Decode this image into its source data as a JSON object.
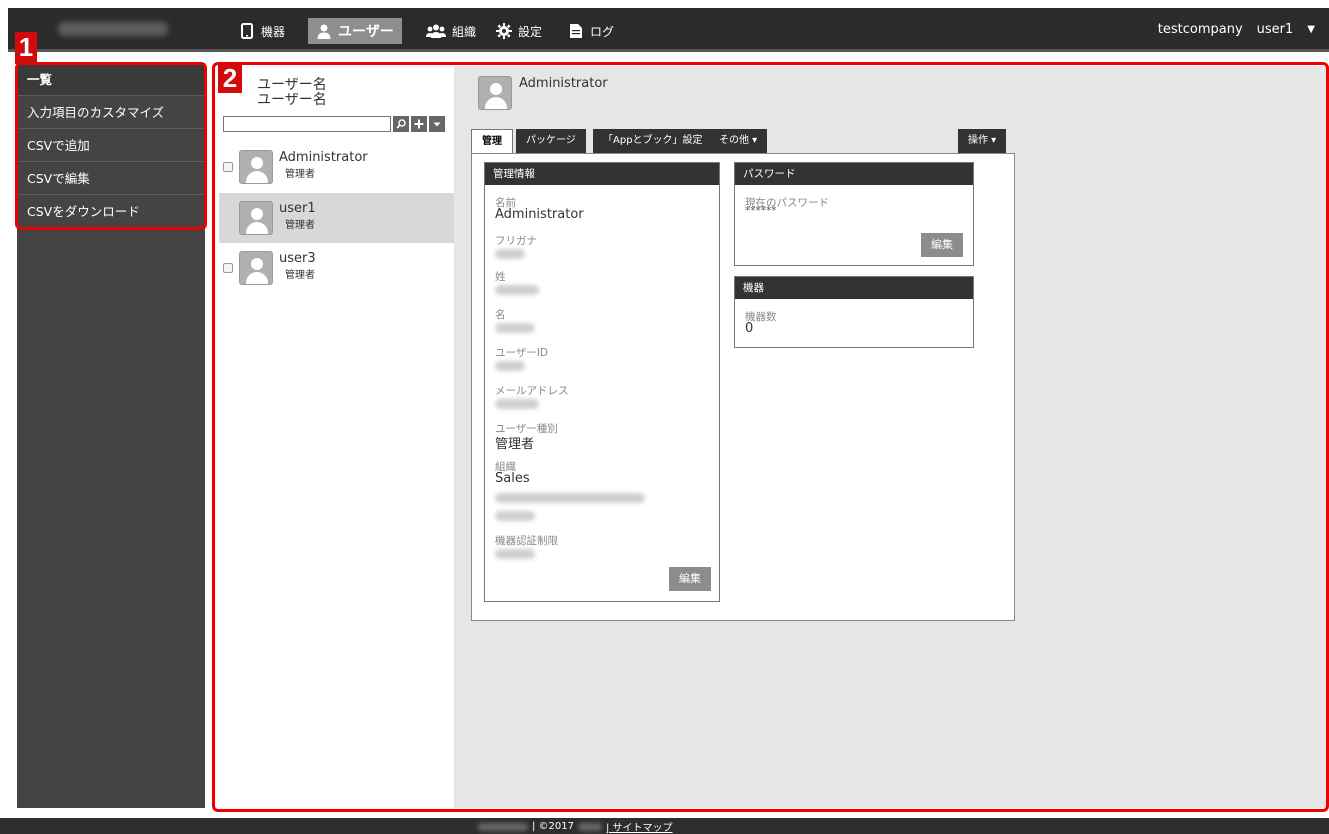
{
  "nav": {
    "items": [
      {
        "label": "機器",
        "icon": "mobile-device-icon"
      },
      {
        "label": "ユーザー",
        "icon": "user-icon"
      },
      {
        "label": "組織",
        "icon": "group-icon"
      },
      {
        "label": "設定",
        "icon": "gear-icon"
      },
      {
        "label": "ログ",
        "icon": "document-icon"
      }
    ],
    "company": "testcompany",
    "current_user": "user1"
  },
  "sidebar": {
    "items": [
      {
        "label": "一覧"
      },
      {
        "label": "入力項目のカスタマイズ"
      },
      {
        "label": "CSVで追加"
      },
      {
        "label": "CSVで編集"
      },
      {
        "label": "CSVをダウンロード"
      }
    ]
  },
  "annotations": {
    "badge1": "1",
    "badge2": "2"
  },
  "userlist": {
    "sort_label_1": "ユーザー名",
    "sort_label_2": "ユーザー名",
    "users": [
      {
        "name": "Administrator",
        "role": "管理者"
      },
      {
        "name": "user1",
        "role": "管理者"
      },
      {
        "name": "user3",
        "role": "管理者"
      }
    ]
  },
  "detail": {
    "title": "Administrator",
    "tabs": [
      {
        "label": "管理"
      },
      {
        "label": "パッケージ"
      },
      {
        "label": "「Appとブック」設定"
      },
      {
        "label": "その他 ▾"
      }
    ],
    "action_tab": "操作 ▾",
    "admin_card": {
      "title": "管理情報",
      "name_label": "名前",
      "name_value": "Administrator",
      "furigana_label": "フリガナ",
      "last_name_label": "姓",
      "first_name_label": "名",
      "user_id_label": "ユーザーID",
      "email_label": "メールアドレス",
      "user_type_label": "ユーザー種別",
      "user_type_value": "管理者",
      "org_label": "組織",
      "org_value": "Sales",
      "device_limit_label": "機器認証制限",
      "edit_label": "編集"
    },
    "password_card": {
      "title": "パスワード",
      "current_label": "現在のパスワード",
      "current_value": "******",
      "edit_label": "編集"
    },
    "device_card": {
      "title": "機器",
      "count_label": "機器数",
      "count_value": "0"
    }
  },
  "footer": {
    "copyright": "| ©2017",
    "sitemap": "| サイトマップ"
  }
}
